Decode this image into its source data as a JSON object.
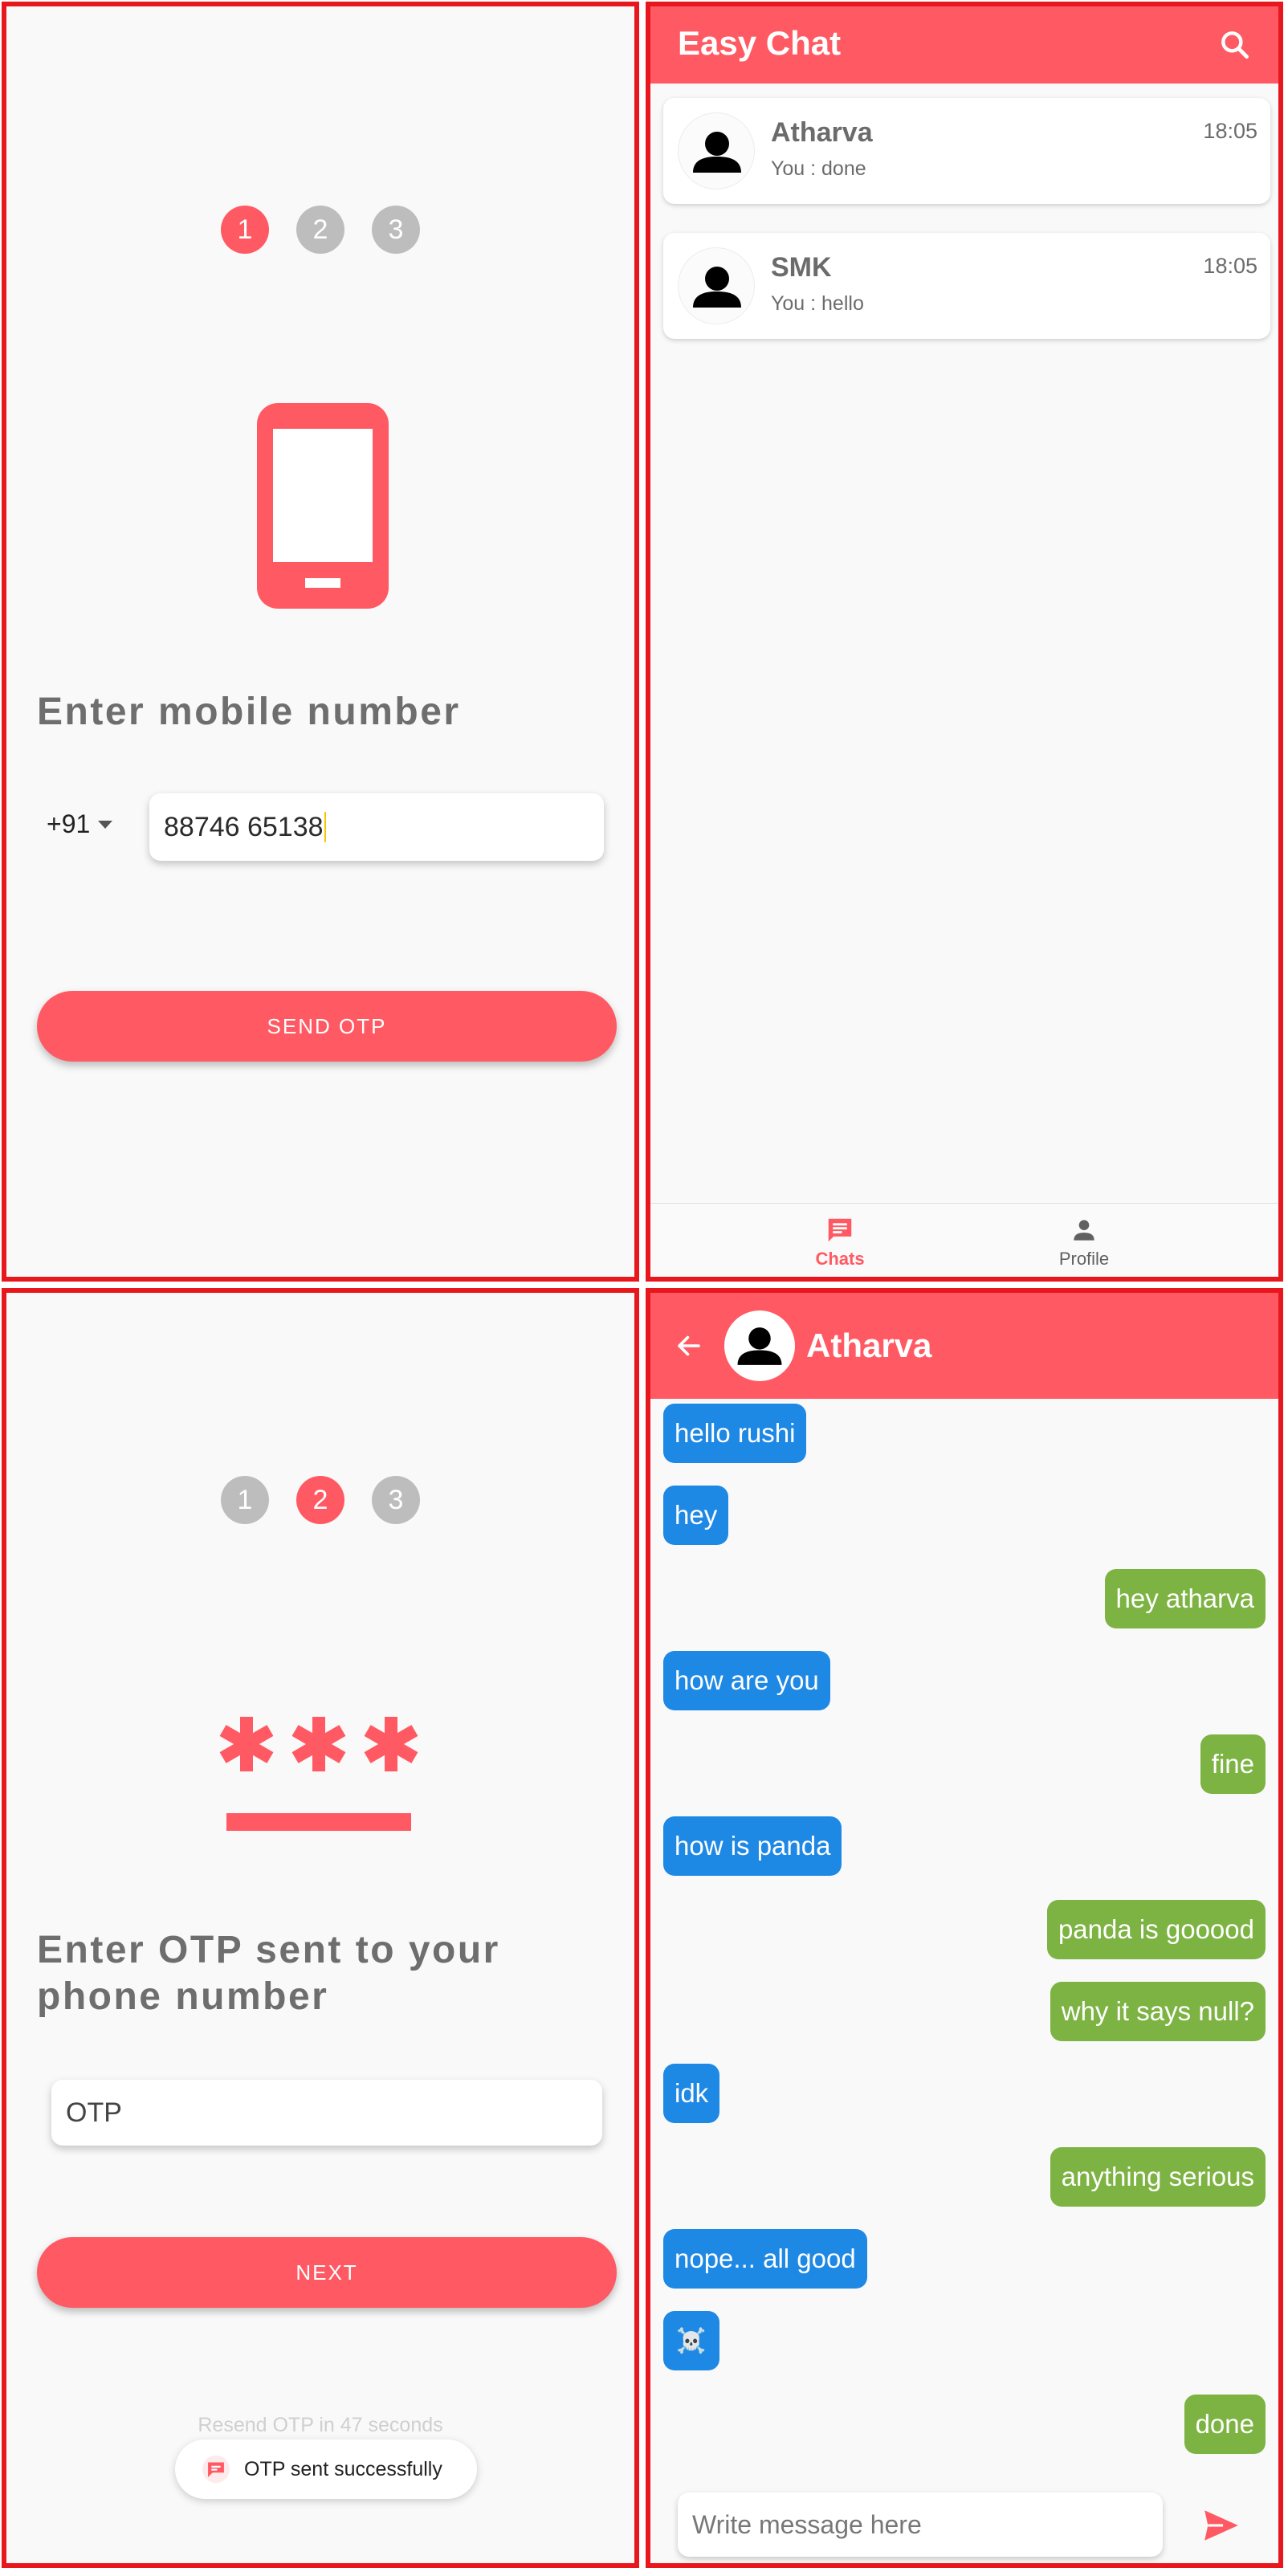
{
  "login": {
    "steps": [
      "1",
      "2",
      "3"
    ],
    "active_step": 1,
    "icon": "smartphone-icon",
    "title": "Enter mobile number",
    "country_code": "+91",
    "phone_value": "88746 65138",
    "send_button": "SEND OTP"
  },
  "chats": {
    "app_title": "Easy Chat",
    "items": [
      {
        "name": "Atharva",
        "last_message": "You : done",
        "time": "18:05"
      },
      {
        "name": "SMK",
        "last_message": "You : hello",
        "time": "18:05"
      }
    ],
    "nav": [
      {
        "label": "Chats",
        "icon": "chat-icon",
        "active": true
      },
      {
        "label": "Profile",
        "icon": "person-icon",
        "active": false
      }
    ]
  },
  "otp": {
    "steps": [
      "1",
      "2",
      "3"
    ],
    "active_step": 2,
    "icon": "password-icon",
    "title_line1": "Enter OTP sent to your",
    "title_line2": "phone number",
    "otp_placeholder": "OTP",
    "next_button": "NEXT",
    "resend_text": "Resend OTP in 47 seconds",
    "toast_text": "OTP sent successfully"
  },
  "conversation": {
    "contact_name": "Atharva",
    "messages": [
      {
        "text": "hello rushi",
        "outgoing": false
      },
      {
        "text": "hey",
        "outgoing": false
      },
      {
        "text": "hey atharva",
        "outgoing": true
      },
      {
        "text": "how are you",
        "outgoing": false
      },
      {
        "text": "fine",
        "outgoing": true
      },
      {
        "text": "how is panda",
        "outgoing": false
      },
      {
        "text": "panda is gooood",
        "outgoing": true
      },
      {
        "text": "why it says null?",
        "outgoing": true
      },
      {
        "text": "idk",
        "outgoing": false
      },
      {
        "text": "anything serious",
        "outgoing": true
      },
      {
        "text": "nope... all good",
        "outgoing": false
      },
      {
        "text": "☠️",
        "outgoing": false
      },
      {
        "text": "done",
        "outgoing": true
      }
    ],
    "input_placeholder": "Write message here"
  },
  "colors": {
    "primary": "#ff5a63",
    "incoming_bubble": "#1e88e5",
    "outgoing_bubble": "#7cb342",
    "frame": "#e8171d"
  }
}
